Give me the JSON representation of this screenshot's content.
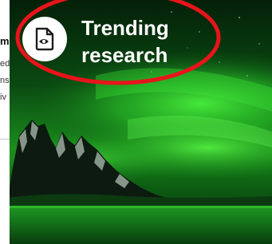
{
  "left_panel": {
    "heading_fragment": "m",
    "line_fragments": [
      "ed",
      "ns",
      "iv"
    ]
  },
  "card": {
    "title_line1": "Trending",
    "title_line2": "research",
    "icon": "document-eye-icon"
  },
  "colors": {
    "annotation": "#e8141b",
    "aurora": "#2fd12e",
    "sky": "#06220a",
    "title": "#ffffff"
  }
}
